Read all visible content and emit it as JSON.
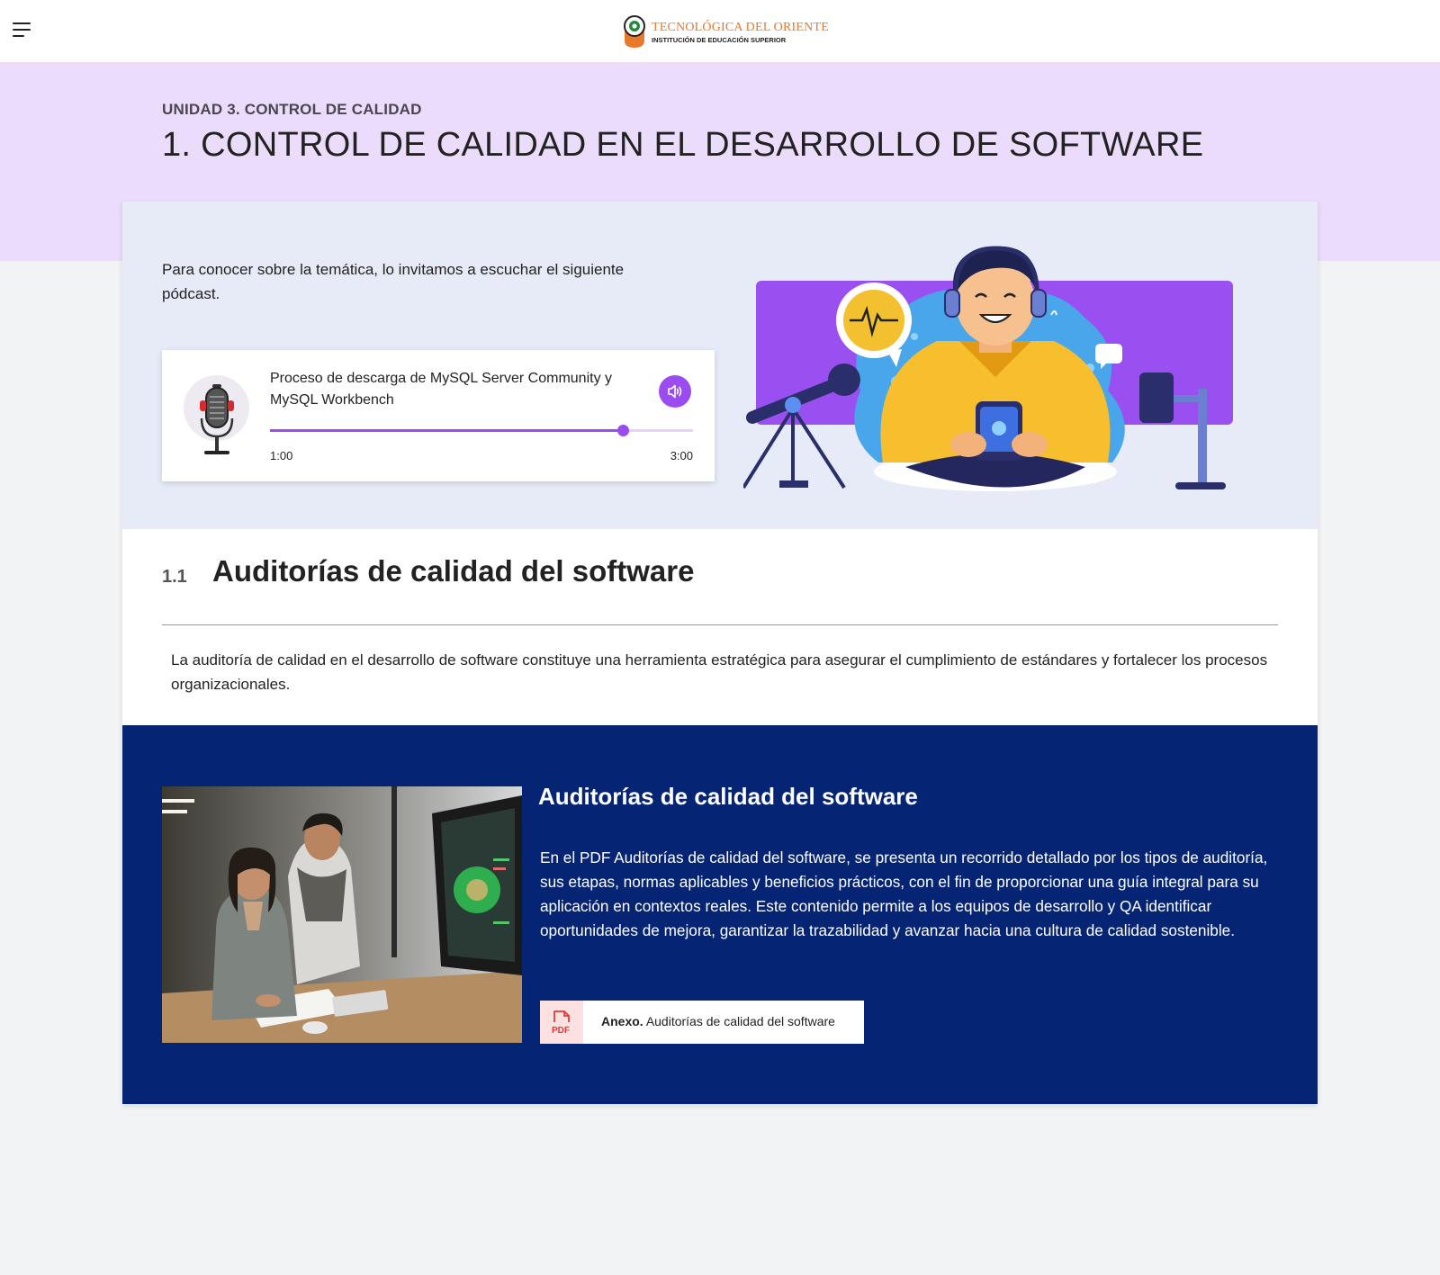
{
  "header": {
    "menu_icon": "hamburger-menu-icon",
    "logo_name": "TECNOLÓGICA DEL ORIENTE",
    "logo_subtitle": "INSTITUCIÓN DE EDUCACIÓN SUPERIOR"
  },
  "hero": {
    "unit": "UNIDAD 3. CONTROL DE CALIDAD",
    "title": "1. CONTROL DE CALIDAD EN EL DESARROLLO DE SOFTWARE"
  },
  "intro": {
    "text": "Para conocer sobre la temática, lo invitamos a escuchar el siguiente pódcast."
  },
  "player": {
    "title": "Proceso de descarga de MySQL Server Community y MySQL Workbench",
    "current_time": "1:00",
    "total_time": "3:00",
    "progress_fraction": 0.835,
    "accent_color": "#9b4cf0"
  },
  "section": {
    "number": "1.1",
    "title": "Auditorías de calidad del software",
    "text": "La auditoría de calidad en el desarrollo de software constituye una herramienta estratégica para asegurar el cumplimiento de estándares y fortalecer los procesos organizacionales."
  },
  "resource": {
    "title": "Auditorías de calidad del software",
    "text": "En el PDF Auditorías de calidad del software, se presenta un recorrido detallado por los tipos de auditoría, sus etapas, normas aplicables y beneficios prácticos, con el fin de proporcionar una guía integral para su aplicación en contextos reales. Este contenido permite a los equipos de desarrollo y QA identificar oportunidades de mejora, garantizar la trazabilidad y avanzar hacia una cultura de calidad sostenible.",
    "pdf_icon_text": "PDF",
    "pdf_label_bold": "Anexo.",
    "pdf_label": "Auditorías de calidad del software",
    "background_color": "#052574"
  },
  "colors": {
    "hero_bg": "#ebdcfc",
    "intro_bg": "#e7ebf8",
    "brand_orange": "#e8792a"
  }
}
